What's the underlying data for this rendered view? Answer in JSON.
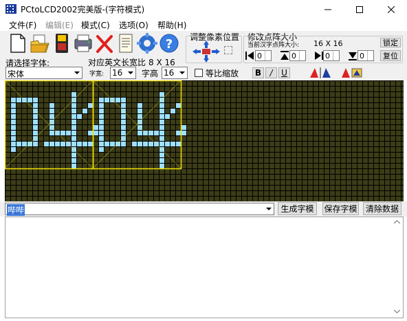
{
  "window": {
    "title": "PCtoLCD2002完美版-(字符模式)",
    "controls": [
      "minimize",
      "maximize",
      "close"
    ]
  },
  "menu": [
    {
      "label": "文件(F)",
      "enabled": true
    },
    {
      "label": "编辑(E)",
      "enabled": false
    },
    {
      "label": "模式(C)",
      "enabled": true
    },
    {
      "label": "选项(O)",
      "enabled": true
    },
    {
      "label": "帮助(H)",
      "enabled": true
    }
  ],
  "toolbar": {
    "icons": [
      "new-icon",
      "open-icon",
      "save-icon",
      "print-icon",
      "delete-icon",
      "notepad-icon",
      "settings-gear-icon",
      "help-icon"
    ],
    "font_label": "请选择字体:",
    "font_value": "宋体",
    "ratio_label": "对应英文长宽比",
    "ratio_value": "8 X 16",
    "spacing_label": "字宽:",
    "spacing_value": "16",
    "height_label": "字高",
    "height_value": "16",
    "proportional_label": "等比缩放",
    "adjust_pixel_label": "调整像素位置",
    "resize_label": "修改点阵大小",
    "current_size_label": "当前汉字点阵大小:",
    "current_size_value": "16 X 16",
    "lock_label": "锁定",
    "reset_label": "复位",
    "spin_values": [
      "0",
      "0",
      "0",
      "0"
    ],
    "style_buttons": [
      "B",
      "/",
      "U"
    ]
  },
  "editor": {
    "bg_color": "#3c3c18",
    "grid_color": "#000000",
    "pixel_on_color": "#9ee0ff",
    "glyph_border_color": "#f0e000",
    "glyph_text": "哔哔"
  },
  "bottom": {
    "input_value": "哔哔",
    "generate_label": "生成字模",
    "save_label": "保存字模",
    "clear_label": "清除数据"
  },
  "output": {
    "content": ""
  }
}
